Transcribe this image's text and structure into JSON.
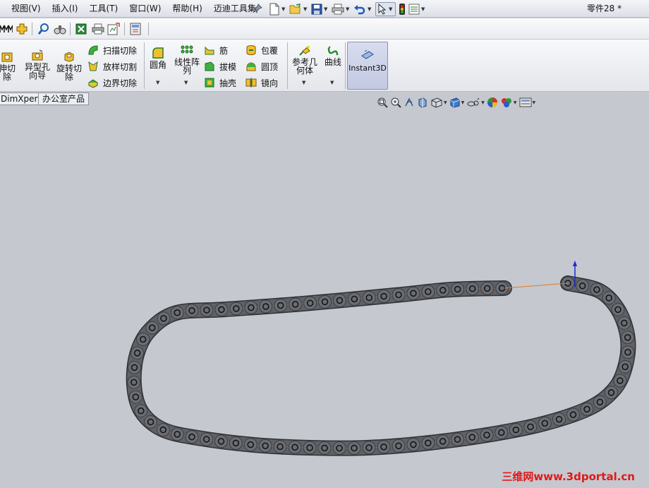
{
  "menu": {
    "items": [
      {
        "label": "视图(V)"
      },
      {
        "label": "插入(I)"
      },
      {
        "label": "工具(T)"
      },
      {
        "label": "窗口(W)"
      },
      {
        "label": "帮助(H)"
      },
      {
        "label": "迈迪工具集"
      }
    ]
  },
  "quick_access": {
    "icons": [
      "new-document-icon",
      "open-folder-icon",
      "save-icon",
      "print-icon",
      "undo-icon",
      "select-cursor-icon",
      "traffic-light-icon",
      "options-icon"
    ]
  },
  "document": {
    "title": "零件28 *"
  },
  "toolbar2": {
    "icons": [
      "mmm-icon",
      "add-part-icon",
      "search-icon",
      "binoculars-icon",
      "excel-icon",
      "printer-icon",
      "edit-sheet-icon",
      "calculator-icon"
    ]
  },
  "ribbon": {
    "extrude_cut": "伸切除",
    "hole_wizard": "异型孔向导",
    "revolve_cut": "旋转切除",
    "sweep_cut": "扫描切除",
    "loft_cut": "放样切割",
    "boundary_cut": "边界切除",
    "fillet": "圆角",
    "linear_pattern": "线性阵列",
    "rib": "筋",
    "draft": "拔模",
    "shell": "抽壳",
    "wrap": "包覆",
    "dome": "圆顶",
    "mirror": "镜向",
    "ref_geometry": "参考几何体",
    "curves": "曲线",
    "instant3d": "Instant3D"
  },
  "tabs": [
    {
      "label": "DimXpert"
    },
    {
      "label": "办公室产品"
    }
  ],
  "colors": {
    "viewport_bg": "#c5c8ce",
    "chain_link": "#5e6167",
    "chain_outline": "#2f3136",
    "path_line": "#e07a2c",
    "watermark": "#e01818"
  },
  "watermark": {
    "text": "三维网www.3dportal.cn"
  }
}
